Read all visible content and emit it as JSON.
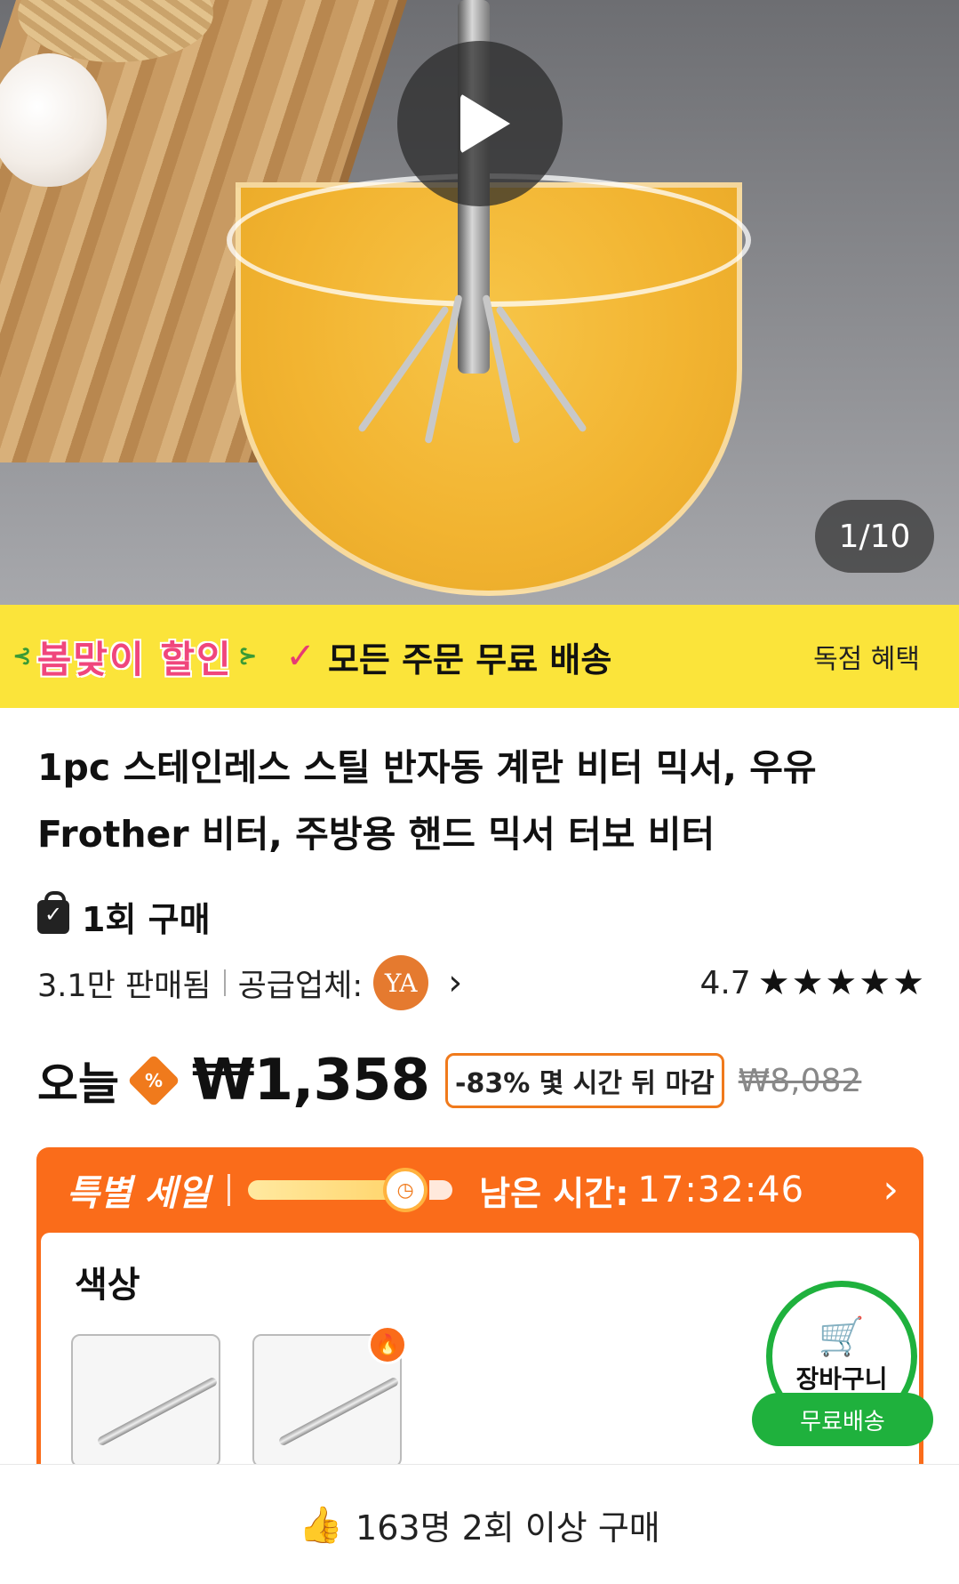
{
  "hero": {
    "counter": "1/10"
  },
  "promo": {
    "sale_label": "봄맞이 할인",
    "free_shipping": "모든 주문 무료 배송",
    "benefit": "독점 혜택"
  },
  "product": {
    "title": "1pc 스테인레스 스틸 반자동 계란 비터 믹서, 우유 Frother 비터, 주방용 핸드 믹서 터보 비터",
    "one_time": "1회 구매",
    "sold": "3.1만 판매됨",
    "supplier_label": "공급업체:",
    "supplier_badge": "YA",
    "rating": "4.7",
    "stars": "★★★★★"
  },
  "price": {
    "today": "오늘",
    "current": "₩1,358",
    "deal": "-83% 몇 시간 뒤 마감",
    "original": "₩8,082"
  },
  "special_sale": {
    "title": "특별 세일",
    "remaining_label": "남은 시간:",
    "timer": "17:32:46",
    "color_label": "색상"
  },
  "cart": {
    "label": "장바구니",
    "free": "무료배송"
  },
  "bottom": {
    "text": "163명 2회 이상 구매"
  }
}
